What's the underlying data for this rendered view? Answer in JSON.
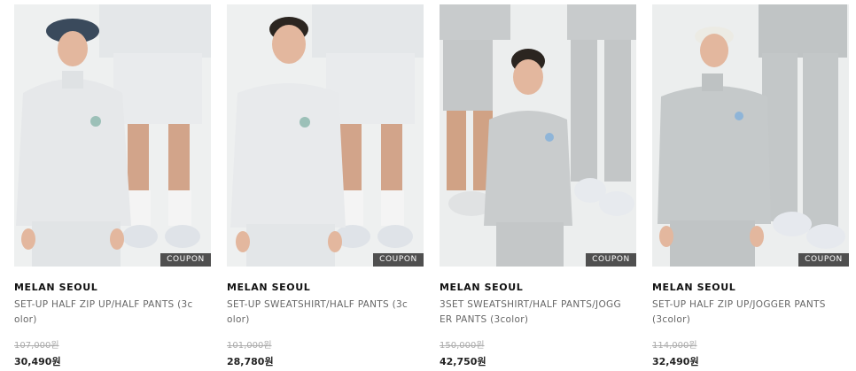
{
  "products": [
    {
      "brand": "MELAN SEOUL",
      "name": "SET-UP HALF ZIP UP/HALF PANTS (3color)",
      "original_price": "107,000원",
      "price": "30,490원",
      "badge": "COUPON",
      "image": "model-gray-half-zip-bucket-hat",
      "colors": {
        "bg": "#eef0f0",
        "garment": "#e6e8ea",
        "hat": "#3a4a5c"
      }
    },
    {
      "brand": "MELAN SEOUL",
      "name": "SET-UP SWEATSHIRT/HALF PANTS (3color)",
      "original_price": "101,000원",
      "price": "28,780원",
      "badge": "COUPON",
      "image": "model-white-sweatshirt",
      "colors": {
        "bg": "#eef0f0",
        "garment": "#e8eaec",
        "hat": ""
      }
    },
    {
      "brand": "MELAN SEOUL",
      "name": "3SET SWEATSHIRT/HALF PANTS/JOGGER PANTS (3color)",
      "original_price": "150,000원",
      "price": "42,750원",
      "badge": "COUPON",
      "image": "model-gray-sweatshirt-jogger",
      "colors": {
        "bg": "#eceeee",
        "garment": "#c9cccd",
        "hat": ""
      }
    },
    {
      "brand": "MELAN SEOUL",
      "name": "SET-UP HALF ZIP UP/JOGGER PANTS (3color)",
      "original_price": "114,000원",
      "price": "32,490원",
      "badge": "COUPON",
      "image": "model-gray-half-zip-cap",
      "colors": {
        "bg": "#eceeee",
        "garment": "#c5c9ca",
        "hat": "#ecebe4"
      }
    }
  ]
}
